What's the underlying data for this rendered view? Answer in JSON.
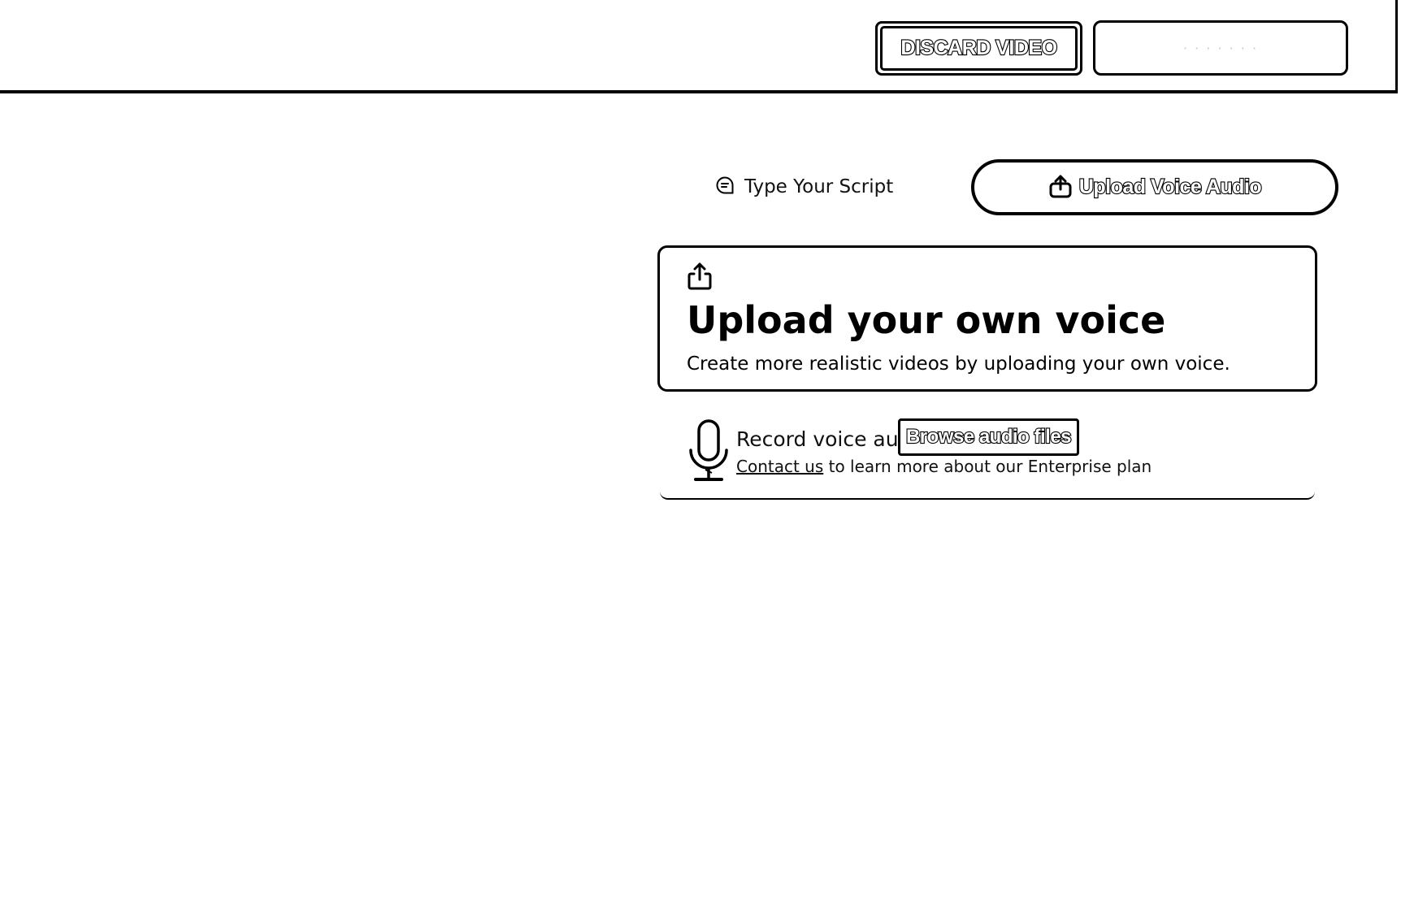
{
  "header": {
    "discard_label": "DISCARD VIDEO",
    "secondary_label": "· · · · · · ·"
  },
  "tabs": [
    {
      "label": "Type Your Script",
      "icon": "chat-icon",
      "active": false
    },
    {
      "label": "Upload Voice Audio",
      "icon": "upload-icon",
      "active": true
    }
  ],
  "upload_card": {
    "icon": "upload-icon",
    "title": "Upload your own voice",
    "description": "Create more realistic videos by uploading your own voice."
  },
  "record": {
    "icon": "microphone-icon",
    "text": "Record voice aud",
    "browse_label": "Browse audio files",
    "contact_link": "Contact us",
    "contact_rest": " to learn more about our Enterprise plan"
  }
}
